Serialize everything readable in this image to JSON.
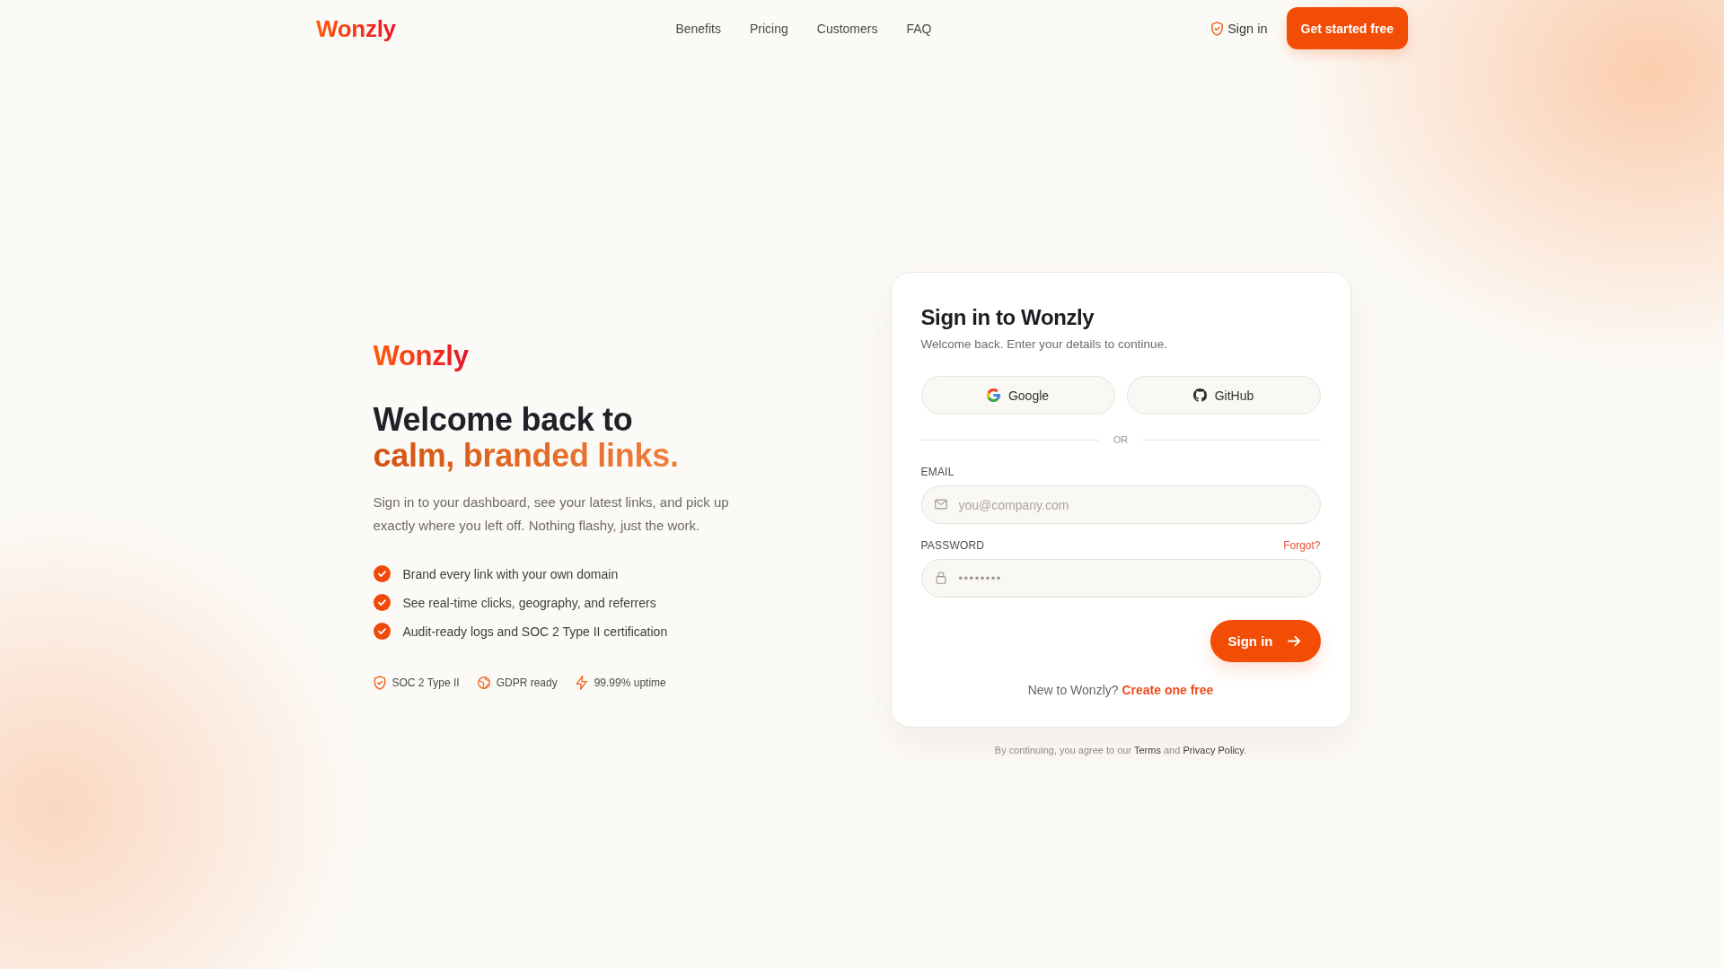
{
  "nav": {
    "logo": "Wonzly",
    "links": [
      {
        "label": "Benefits"
      },
      {
        "label": "Pricing"
      },
      {
        "label": "Customers"
      },
      {
        "label": "FAQ"
      }
    ],
    "sign_in": "Sign in",
    "cta": "Get started free"
  },
  "hero": {
    "logo": "Wonzly",
    "headline": "Welcome back to",
    "headline_accent": "calm, branded links.",
    "intro": "Sign in to your dashboard, see your latest links, and pick up exactly where you left off. Nothing flashy, just the work.",
    "features": [
      "Brand every link with your own domain",
      "See real-time clicks, geography, and referrers",
      "Audit-ready logs and SOC 2 Type II certification"
    ],
    "badges": [
      {
        "label": "SOC 2 Type II"
      },
      {
        "label": "GDPR ready"
      },
      {
        "label": "99.99% uptime"
      }
    ]
  },
  "card": {
    "title": "Sign in to Wonzly",
    "subtitle": "Welcome back. Enter your details to continue.",
    "social": [
      {
        "label": "Google"
      },
      {
        "label": "GitHub"
      }
    ],
    "divider": "OR",
    "fields": [
      {
        "kind": "email",
        "label": "EMAIL",
        "placeholder": "you@company.com"
      },
      {
        "kind": "password",
        "label": "PASSWORD",
        "link": "Forgot?",
        "value": "••••••••"
      }
    ],
    "submit": "Sign in",
    "signup_prompt": "New to Wonzly?",
    "signup_link": "Create one free"
  },
  "legal": {
    "text_before": "By continuing, you agree to our",
    "terms": "Terms",
    "text_between": "and",
    "privacy": "Privacy Policy",
    "text_after": "."
  }
}
